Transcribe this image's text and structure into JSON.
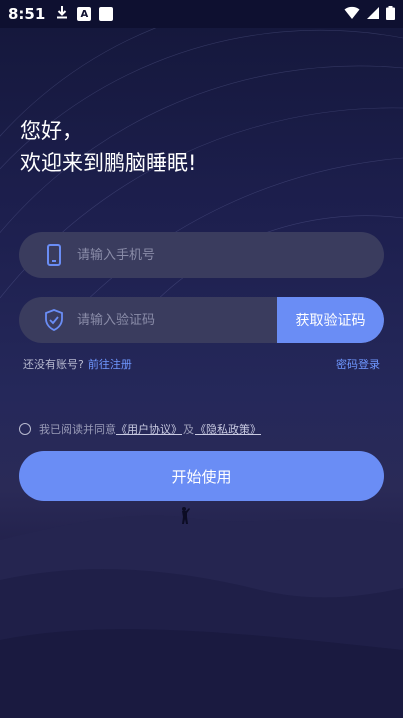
{
  "status_bar": {
    "time": "8:51",
    "badge_letter": "A"
  },
  "greeting": {
    "line1": "您好，",
    "line2": "欢迎来到鹏脑睡眠!"
  },
  "phone_field": {
    "placeholder": "请输入手机号"
  },
  "code_field": {
    "placeholder": "请输入验证码",
    "button_label": "获取验证码"
  },
  "links": {
    "no_account": "还没有账号?",
    "register": "前往注册",
    "password_login": "密码登录"
  },
  "agreement": {
    "prefix": "我已阅读并同意",
    "user_agreement": "《用户协议》",
    "and": "及",
    "privacy_policy": "《隐私政策》"
  },
  "start_button": {
    "label": "开始使用"
  },
  "colors": {
    "accent": "#6a8df5",
    "field_bg": "#3a3c5e",
    "background": "#1d1f4e"
  },
  "icons": [
    "download-icon",
    "phone-icon",
    "shield-icon",
    "wifi-icon",
    "signal-icon",
    "battery-icon"
  ]
}
